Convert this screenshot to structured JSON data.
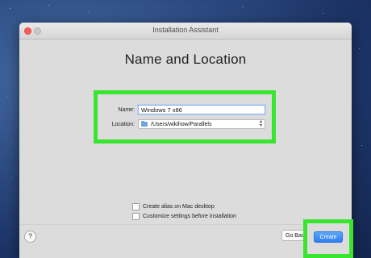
{
  "window": {
    "title": "Installation Assistant"
  },
  "page": {
    "heading": "Name and Location"
  },
  "form": {
    "name_label": "Name:",
    "name_value": "Windows 7 x86",
    "location_label": "Location:",
    "location_value": "/Users/wikihow/Parallels",
    "location_icon": "folder-icon"
  },
  "options": {
    "alias_label": "Create alias on Mac desktop",
    "customize_label": "Customize settings before installation"
  },
  "footer": {
    "help_label": "?",
    "go_back_label": "Go Bac",
    "create_label": "Create"
  },
  "colors": {
    "highlight": "#39e62f",
    "primary_button": "#2f7ff0",
    "close_button": "#fc5d57"
  }
}
